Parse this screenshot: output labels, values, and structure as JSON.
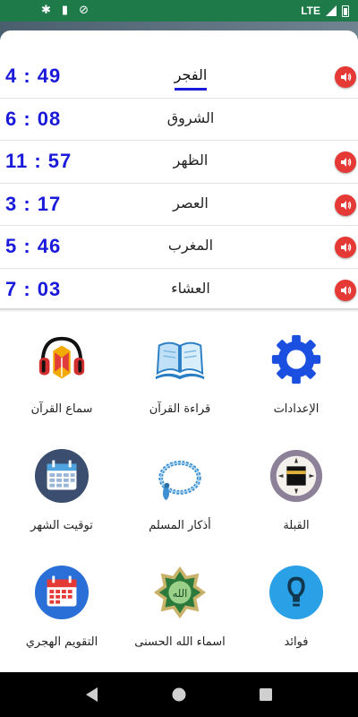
{
  "status_bar": {
    "network": "LTE"
  },
  "prayers": [
    {
      "name": "الفجر",
      "time": "4 : 49",
      "has_sound": true,
      "active": true
    },
    {
      "name": "الشروق",
      "time": "6 : 08",
      "has_sound": false,
      "active": false
    },
    {
      "name": "الظهر",
      "time": "11 : 57",
      "has_sound": true,
      "active": false
    },
    {
      "name": "العصر",
      "time": "3 : 17",
      "has_sound": true,
      "active": false
    },
    {
      "name": "المغرب",
      "time": "5 : 46",
      "has_sound": true,
      "active": false
    },
    {
      "name": "العشاء",
      "time": "7 : 03",
      "has_sound": true,
      "active": false
    }
  ],
  "menu": [
    {
      "label": "الإعدادات",
      "icon": "gear-icon"
    },
    {
      "label": "قراءة القرآن",
      "icon": "open-book-icon"
    },
    {
      "label": "سماع القرآن",
      "icon": "headphones-quran-icon"
    },
    {
      "label": "القبلة",
      "icon": "qibla-compass-icon"
    },
    {
      "label": "أذكار المسلم",
      "icon": "prayer-beads-icon"
    },
    {
      "label": "توقيت الشهر",
      "icon": "calendar-month-icon"
    },
    {
      "label": "فوائد",
      "icon": "lightbulb-icon"
    },
    {
      "label": "اسماء الله الحسنى",
      "icon": "allah-names-icon"
    },
    {
      "label": "التقويم الهجري",
      "icon": "hijri-calendar-icon"
    }
  ],
  "colors": {
    "time_blue": "#1a1adb",
    "sound_red": "#e53935",
    "status_green": "#1f7a4a"
  }
}
